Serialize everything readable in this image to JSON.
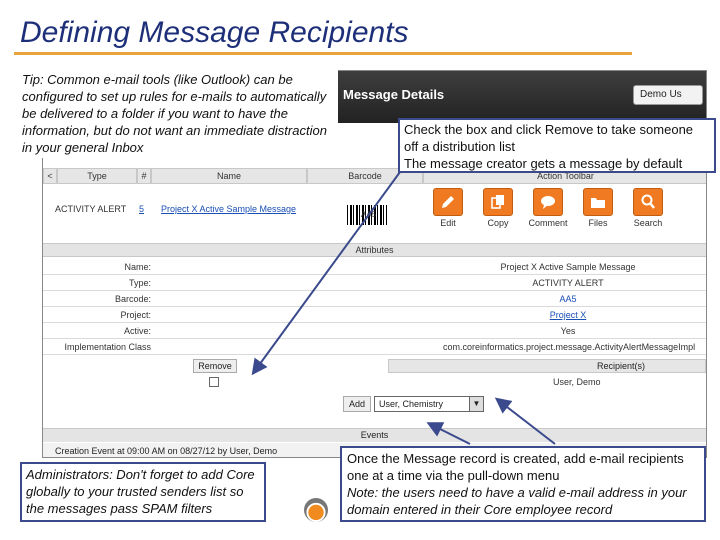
{
  "slide": {
    "title": "Defining Message Recipients"
  },
  "app": {
    "header_title": "Message Details",
    "user_button": "Demo Us",
    "grid_columns": [
      "Type",
      "#",
      "Name",
      "Barcode",
      "Action Toolbar"
    ],
    "row": {
      "type": "ACTIVITY ALERT",
      "number": "5",
      "name": "Project X Active Sample Message",
      "barcode": "AA5"
    },
    "toolbar": [
      {
        "label": "Edit",
        "icon": "pencil-icon"
      },
      {
        "label": "Copy",
        "icon": "copy-icon"
      },
      {
        "label": "Comment",
        "icon": "comment-icon"
      },
      {
        "label": "Files",
        "icon": "files-icon"
      },
      {
        "label": "Search",
        "icon": "search-icon"
      }
    ],
    "attributes_title": "Attributes",
    "attributes": [
      {
        "label": "Name:",
        "value": "Project X Active Sample Message"
      },
      {
        "label": "Type:",
        "value": "ACTIVITY ALERT"
      },
      {
        "label": "Barcode:",
        "value": "AA5"
      },
      {
        "label": "Project:",
        "value": "Project X"
      },
      {
        "label": "Active:",
        "value": "Yes"
      },
      {
        "label": "Implementation Class",
        "value": "com.coreinformatics.project.message.ActivityAlertMessageImpl"
      }
    ],
    "remove_label": "Remove",
    "recipients_header": "Recipient(s)",
    "recipient": "User, Demo",
    "add_label": "Add",
    "select_value": "User, Chemistry",
    "events_title": "Events",
    "creation_text": "Creation Event at 09:00 AM on 08/27/12 by User, Demo"
  },
  "callouts": {
    "tip": "Tip: Common e-mail tools (like Outlook) can be configured to set up rules for e-mails to automatically be delivered to a folder if you want to have the information, but do not want an immediate distraction in your general Inbox",
    "check_line1": "Check the box and click Remove to take someone off a distribution list",
    "check_line2": "The message creator gets a message by default",
    "admin": "Administrators: Don't forget to add Core globally to your trusted senders list so the messages pass SPAM filters",
    "once_line1": "Once the Message record is created, add e-mail recipients one at a time via the pull-down menu",
    "once_note": "Note: the users need to have a valid e-mail address in your domain entered in their Core employee record"
  },
  "colors": {
    "title": "#1d2f78",
    "accent": "#e8a33a",
    "toolbar_orange": "#f07a21",
    "callout_border": "#3b4a8c"
  }
}
